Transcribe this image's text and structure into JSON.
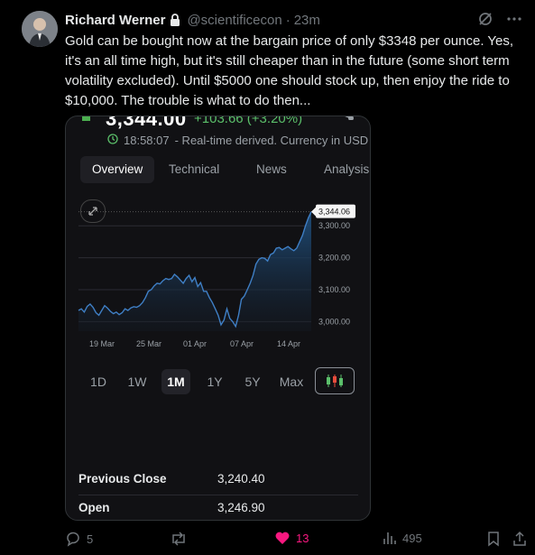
{
  "tweet": {
    "author": {
      "name": "Richard Werner",
      "handle": "@scientificecon",
      "time": "23m"
    },
    "text": "Gold can be bought now at the bargain price of only $3348 per ounce. Yes, it's an all time high, but it's still cheaper than in the future (some short term volatility excluded). Until $5000 one should stock up, then enjoy the ride to $10,000. The trouble is what to do then...",
    "media": {
      "price": "3,344.06",
      "price_display": "3,344.00",
      "change": "+103.66 (+3.20%)",
      "status_time": "18:58:07",
      "status_text": "- Real-time derived. Currency in USD",
      "tabs": [
        "Overview",
        "Technical",
        "News",
        "Analysis"
      ],
      "ranges": [
        "1D",
        "1W",
        "1M",
        "1Y",
        "5Y",
        "Max"
      ],
      "active_range": "1M",
      "stats": [
        {
          "label": "Previous Close",
          "value": "3,240.40"
        },
        {
          "label": "Open",
          "value": "3,246.90"
        }
      ]
    },
    "actions": {
      "replies": "5",
      "reposts": "",
      "likes": "13",
      "views": "495"
    }
  },
  "chart_data": {
    "type": "area",
    "x_ticks": [
      "19 Mar",
      "25 Mar",
      "01 Apr",
      "07 Apr",
      "14 Apr"
    ],
    "y_ticks": [
      "3,000.00",
      "3,100.00",
      "3,200.00",
      "3,300.00"
    ],
    "ylim": [
      2970,
      3360
    ],
    "last_label": "3,344.06",
    "series": [
      {
        "values": [
          3035,
          3040,
          3030,
          3048,
          3055,
          3045,
          3028,
          3020,
          3035,
          3050,
          3042,
          3032,
          3025,
          3030,
          3022,
          3028,
          3040,
          3035,
          3043,
          3047,
          3045,
          3050,
          3060,
          3075,
          3095,
          3100,
          3112,
          3120,
          3118,
          3128,
          3135,
          3132,
          3135,
          3148,
          3140,
          3130,
          3120,
          3135,
          3145,
          3125,
          3138,
          3110,
          3122,
          3095,
          3095,
          3075,
          3060,
          3040,
          3020,
          2990,
          3005,
          3040,
          3010,
          3000,
          2985,
          3020,
          3070,
          3080,
          3100,
          3120,
          3145,
          3180,
          3195,
          3200,
          3198,
          3190,
          3210,
          3215,
          3230,
          3232,
          3225,
          3230,
          3235,
          3228,
          3222,
          3230,
          3250,
          3270,
          3300,
          3325,
          3344.06
        ]
      }
    ],
    "colors": {
      "line": "#3f7fc5",
      "fill_top": "#1f4f7d",
      "fill_bottom": "#141a24"
    }
  },
  "colors": {
    "positive": "#5bbf6a",
    "like": "#f91880",
    "muted": "#71767b"
  }
}
